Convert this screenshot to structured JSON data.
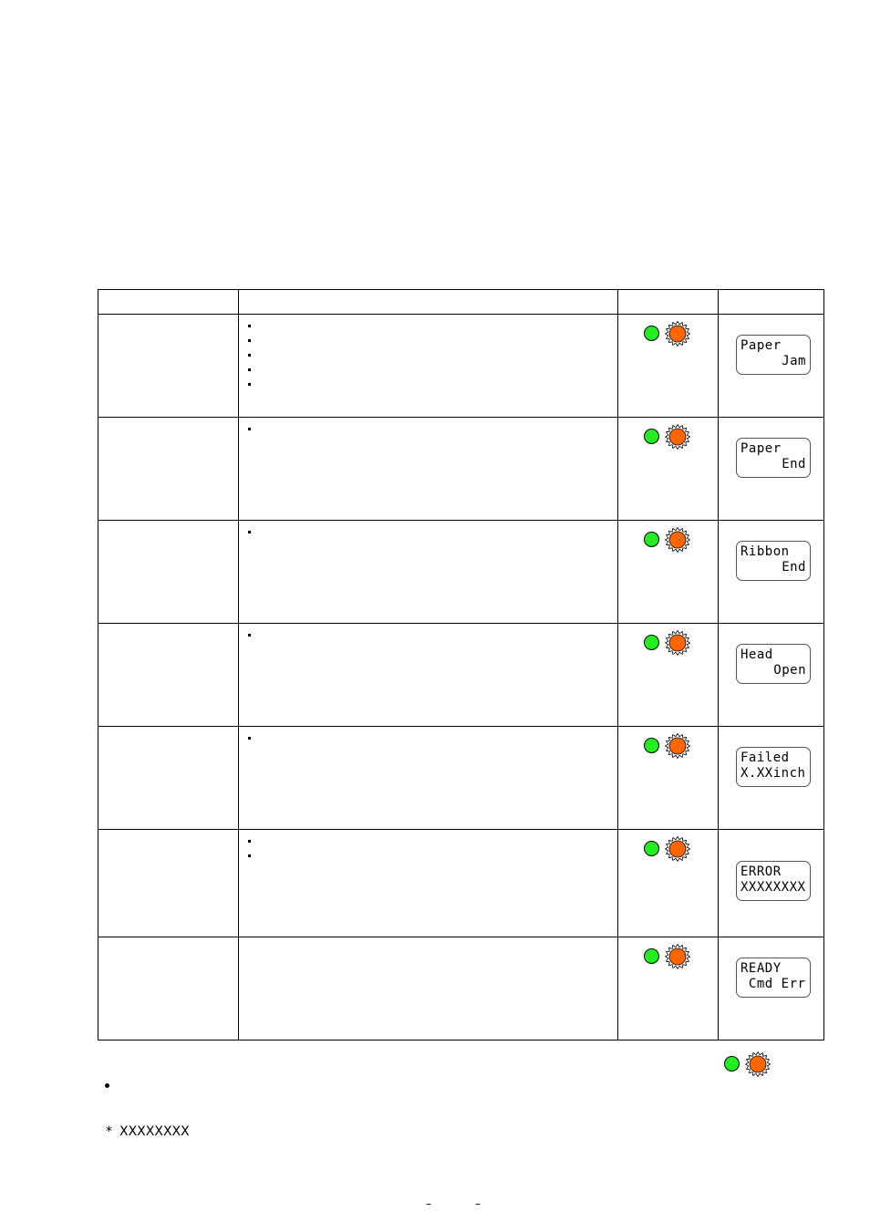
{
  "table": {
    "headers": [
      "",
      "",
      "",
      ""
    ],
    "rows": [
      {
        "bullets": 5,
        "lcd": [
          "Paper",
          "Jam"
        ],
        "lcd_align": "right"
      },
      {
        "bullets": 1,
        "lcd": [
          "Paper",
          "End"
        ],
        "lcd_align": "right"
      },
      {
        "bullets": 1,
        "lcd": [
          "Ribbon",
          "End"
        ],
        "lcd_align": "right"
      },
      {
        "bullets": 1,
        "lcd": [
          "Head",
          "Open"
        ],
        "lcd_align": "right"
      },
      {
        "bullets": 1,
        "lcd": [
          "Failed",
          "X.XXinch"
        ],
        "lcd_align": "left"
      },
      {
        "bullets": 2,
        "lcd": [
          "ERROR",
          "XXXXXXXX"
        ],
        "lcd_align": "left",
        "lcd_marker": "*"
      },
      {
        "bullets": 0,
        "lcd": [
          "READY",
          " Cmd Err"
        ],
        "lcd_align": "left"
      }
    ]
  },
  "led_indicator": {
    "green_state": "on",
    "orange_state": "blinking",
    "green_color": "#22ee22",
    "orange_color": "#ff6600"
  },
  "footnote": {
    "marker": "*",
    "text": "XXXXXXXX"
  },
  "page_number": "– –"
}
